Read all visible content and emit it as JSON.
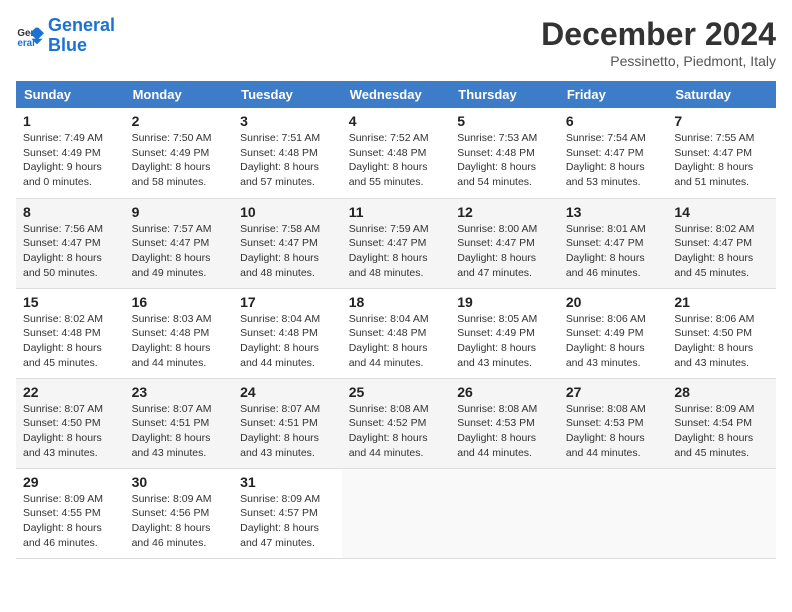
{
  "logo": {
    "line1": "General",
    "line2": "Blue"
  },
  "title": "December 2024",
  "subtitle": "Pessinetto, Piedmont, Italy",
  "weekdays": [
    "Sunday",
    "Monday",
    "Tuesday",
    "Wednesday",
    "Thursday",
    "Friday",
    "Saturday"
  ],
  "weeks": [
    [
      {
        "day": "1",
        "sunrise": "Sunrise: 7:49 AM",
        "sunset": "Sunset: 4:49 PM",
        "daylight": "Daylight: 9 hours and 0 minutes."
      },
      {
        "day": "2",
        "sunrise": "Sunrise: 7:50 AM",
        "sunset": "Sunset: 4:49 PM",
        "daylight": "Daylight: 8 hours and 58 minutes."
      },
      {
        "day": "3",
        "sunrise": "Sunrise: 7:51 AM",
        "sunset": "Sunset: 4:48 PM",
        "daylight": "Daylight: 8 hours and 57 minutes."
      },
      {
        "day": "4",
        "sunrise": "Sunrise: 7:52 AM",
        "sunset": "Sunset: 4:48 PM",
        "daylight": "Daylight: 8 hours and 55 minutes."
      },
      {
        "day": "5",
        "sunrise": "Sunrise: 7:53 AM",
        "sunset": "Sunset: 4:48 PM",
        "daylight": "Daylight: 8 hours and 54 minutes."
      },
      {
        "day": "6",
        "sunrise": "Sunrise: 7:54 AM",
        "sunset": "Sunset: 4:47 PM",
        "daylight": "Daylight: 8 hours and 53 minutes."
      },
      {
        "day": "7",
        "sunrise": "Sunrise: 7:55 AM",
        "sunset": "Sunset: 4:47 PM",
        "daylight": "Daylight: 8 hours and 51 minutes."
      }
    ],
    [
      {
        "day": "8",
        "sunrise": "Sunrise: 7:56 AM",
        "sunset": "Sunset: 4:47 PM",
        "daylight": "Daylight: 8 hours and 50 minutes."
      },
      {
        "day": "9",
        "sunrise": "Sunrise: 7:57 AM",
        "sunset": "Sunset: 4:47 PM",
        "daylight": "Daylight: 8 hours and 49 minutes."
      },
      {
        "day": "10",
        "sunrise": "Sunrise: 7:58 AM",
        "sunset": "Sunset: 4:47 PM",
        "daylight": "Daylight: 8 hours and 48 minutes."
      },
      {
        "day": "11",
        "sunrise": "Sunrise: 7:59 AM",
        "sunset": "Sunset: 4:47 PM",
        "daylight": "Daylight: 8 hours and 48 minutes."
      },
      {
        "day": "12",
        "sunrise": "Sunrise: 8:00 AM",
        "sunset": "Sunset: 4:47 PM",
        "daylight": "Daylight: 8 hours and 47 minutes."
      },
      {
        "day": "13",
        "sunrise": "Sunrise: 8:01 AM",
        "sunset": "Sunset: 4:47 PM",
        "daylight": "Daylight: 8 hours and 46 minutes."
      },
      {
        "day": "14",
        "sunrise": "Sunrise: 8:02 AM",
        "sunset": "Sunset: 4:47 PM",
        "daylight": "Daylight: 8 hours and 45 minutes."
      }
    ],
    [
      {
        "day": "15",
        "sunrise": "Sunrise: 8:02 AM",
        "sunset": "Sunset: 4:48 PM",
        "daylight": "Daylight: 8 hours and 45 minutes."
      },
      {
        "day": "16",
        "sunrise": "Sunrise: 8:03 AM",
        "sunset": "Sunset: 4:48 PM",
        "daylight": "Daylight: 8 hours and 44 minutes."
      },
      {
        "day": "17",
        "sunrise": "Sunrise: 8:04 AM",
        "sunset": "Sunset: 4:48 PM",
        "daylight": "Daylight: 8 hours and 44 minutes."
      },
      {
        "day": "18",
        "sunrise": "Sunrise: 8:04 AM",
        "sunset": "Sunset: 4:48 PM",
        "daylight": "Daylight: 8 hours and 44 minutes."
      },
      {
        "day": "19",
        "sunrise": "Sunrise: 8:05 AM",
        "sunset": "Sunset: 4:49 PM",
        "daylight": "Daylight: 8 hours and 43 minutes."
      },
      {
        "day": "20",
        "sunrise": "Sunrise: 8:06 AM",
        "sunset": "Sunset: 4:49 PM",
        "daylight": "Daylight: 8 hours and 43 minutes."
      },
      {
        "day": "21",
        "sunrise": "Sunrise: 8:06 AM",
        "sunset": "Sunset: 4:50 PM",
        "daylight": "Daylight: 8 hours and 43 minutes."
      }
    ],
    [
      {
        "day": "22",
        "sunrise": "Sunrise: 8:07 AM",
        "sunset": "Sunset: 4:50 PM",
        "daylight": "Daylight: 8 hours and 43 minutes."
      },
      {
        "day": "23",
        "sunrise": "Sunrise: 8:07 AM",
        "sunset": "Sunset: 4:51 PM",
        "daylight": "Daylight: 8 hours and 43 minutes."
      },
      {
        "day": "24",
        "sunrise": "Sunrise: 8:07 AM",
        "sunset": "Sunset: 4:51 PM",
        "daylight": "Daylight: 8 hours and 43 minutes."
      },
      {
        "day": "25",
        "sunrise": "Sunrise: 8:08 AM",
        "sunset": "Sunset: 4:52 PM",
        "daylight": "Daylight: 8 hours and 44 minutes."
      },
      {
        "day": "26",
        "sunrise": "Sunrise: 8:08 AM",
        "sunset": "Sunset: 4:53 PM",
        "daylight": "Daylight: 8 hours and 44 minutes."
      },
      {
        "day": "27",
        "sunrise": "Sunrise: 8:08 AM",
        "sunset": "Sunset: 4:53 PM",
        "daylight": "Daylight: 8 hours and 44 minutes."
      },
      {
        "day": "28",
        "sunrise": "Sunrise: 8:09 AM",
        "sunset": "Sunset: 4:54 PM",
        "daylight": "Daylight: 8 hours and 45 minutes."
      }
    ],
    [
      {
        "day": "29",
        "sunrise": "Sunrise: 8:09 AM",
        "sunset": "Sunset: 4:55 PM",
        "daylight": "Daylight: 8 hours and 46 minutes."
      },
      {
        "day": "30",
        "sunrise": "Sunrise: 8:09 AM",
        "sunset": "Sunset: 4:56 PM",
        "daylight": "Daylight: 8 hours and 46 minutes."
      },
      {
        "day": "31",
        "sunrise": "Sunrise: 8:09 AM",
        "sunset": "Sunset: 4:57 PM",
        "daylight": "Daylight: 8 hours and 47 minutes."
      },
      null,
      null,
      null,
      null
    ]
  ]
}
